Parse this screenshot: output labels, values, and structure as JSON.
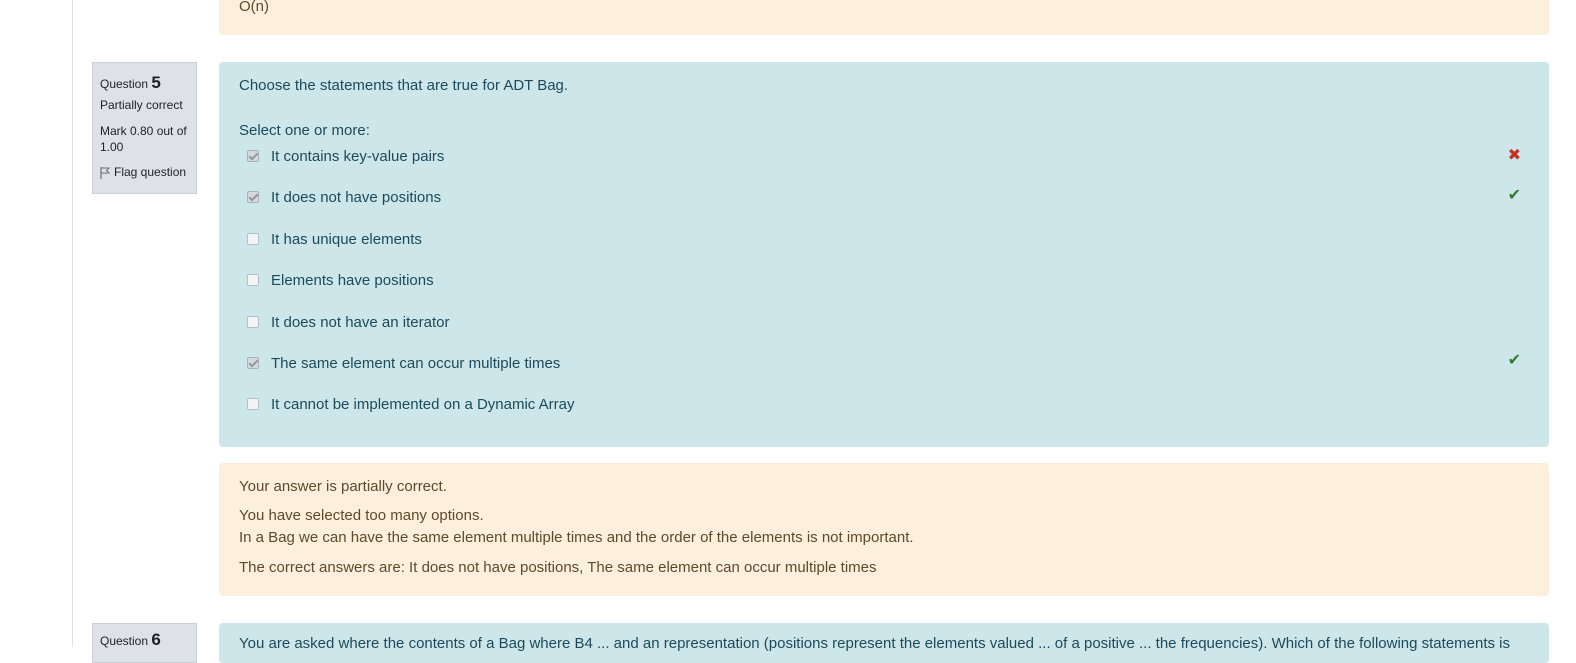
{
  "previous_question": {
    "feedback_tail": "O(n)"
  },
  "question5": {
    "label": "Question",
    "number": "5",
    "state": "Partially correct",
    "grade": "Mark 0.80 out of 1.00",
    "flag_label": "Flag question",
    "text": "Choose the statements that are true for ADT Bag.",
    "prompt": "Select one or more:",
    "options": [
      {
        "label": "It contains key-value pairs",
        "checked": true,
        "mark": "wrong"
      },
      {
        "label": "It does not have positions",
        "checked": true,
        "mark": "correct"
      },
      {
        "label": "It has unique elements",
        "checked": false,
        "mark": ""
      },
      {
        "label": "Elements have positions",
        "checked": false,
        "mark": ""
      },
      {
        "label": "It does not have an iterator",
        "checked": false,
        "mark": ""
      },
      {
        "label": "The same element can occur multiple times",
        "checked": true,
        "mark": "correct"
      },
      {
        "label": "It cannot be implemented on a Dynamic Array",
        "checked": false,
        "mark": ""
      }
    ],
    "feedback": {
      "outcome": "Your answer is partially correct.",
      "specific": "You have selected too many options.",
      "general": "In a Bag we can have the same element multiple times and the order of the elements is not important.",
      "right_answer": "The correct answers are: It does not have positions, The same element can occur multiple times"
    }
  },
  "question6": {
    "label": "Question",
    "number": "6",
    "text_fragment": "You are asked where the contents of a Bag where B4 ... and an representation (positions represent the elements valued ... of a positive ... the frequencies). Which of the following statements is"
  },
  "icons": {
    "wrong": "times-icon",
    "correct": "check-icon",
    "flag": "flag-icon"
  },
  "colors": {
    "question_bg": "#cce6ea",
    "feedback_bg": "#fcefdc",
    "wrong": "#ca3120",
    "correct": "#357a32"
  }
}
